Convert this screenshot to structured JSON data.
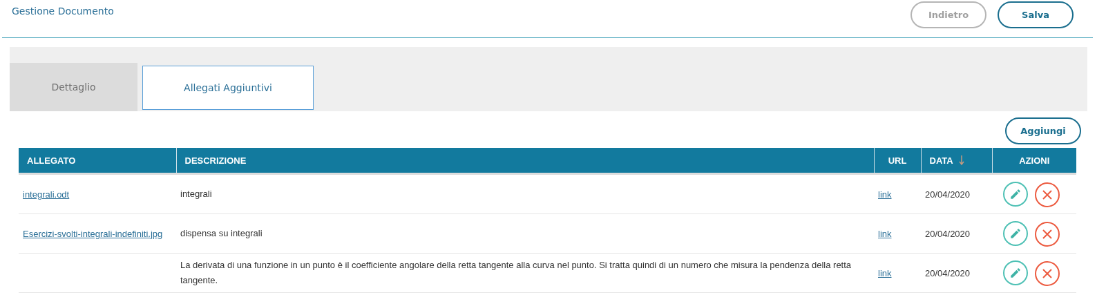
{
  "header": {
    "title": "Gestione Documento",
    "buttons": [
      {
        "label": "Indietro",
        "disabled": true
      },
      {
        "label": "Salva",
        "disabled": false
      }
    ]
  },
  "tabs": [
    {
      "label": "Dettaglio",
      "selected": false
    },
    {
      "label": "Allegati Aggiuntivi",
      "selected": true
    }
  ],
  "add_button": "Aggiungi",
  "table": {
    "columns": [
      {
        "label": "ALLEGATO",
        "sorted": false
      },
      {
        "label": "DESCRIZIONE",
        "sorted": false
      },
      {
        "label": "URL",
        "sorted": false
      },
      {
        "label": "DATA",
        "sorted": true
      },
      {
        "label": "AZIONI",
        "sorted": false
      }
    ],
    "rows": [
      {
        "allegato": "integrali.odt",
        "descrizione": "integrali",
        "url": "link",
        "data": "20/04/2020"
      },
      {
        "allegato": "Esercizi-svolti-integrali-indefiniti.jpg",
        "descrizione": "dispensa su integrali",
        "url": "link",
        "data": "20/04/2020"
      },
      {
        "descrizione": "La derivata di una funzione in un punto è il coefficiente angolare della retta tangente alla curva nel punto. Si tratta quindi di un numero che misura la pendenza della retta tangente.",
        "url": "link",
        "data": "20/04/2020"
      }
    ]
  }
}
